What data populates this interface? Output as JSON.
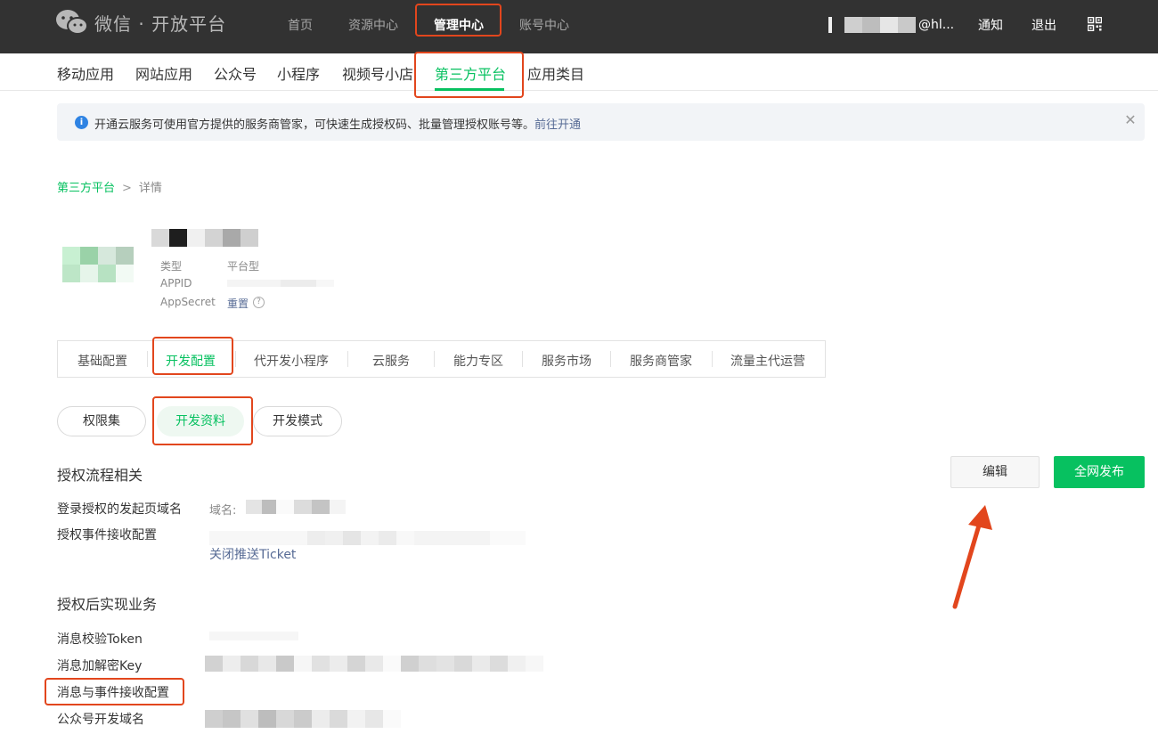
{
  "header": {
    "brand": "微信 · 开放平台",
    "nav": [
      "首页",
      "资源中心",
      "管理中心",
      "账号中心"
    ],
    "active_nav": "管理中心",
    "email_visible": "@hl...",
    "notify": "通知",
    "logout": "退出"
  },
  "subnav": {
    "items": [
      "移动应用",
      "网站应用",
      "公众号",
      "小程序",
      "视频号小店",
      "第三方平台",
      "应用类目"
    ],
    "active": "第三方平台"
  },
  "notice": {
    "text": "开通云服务可使用官方提供的服务商管家，可快速生成授权码、批量管理授权账号等。",
    "link": "前往开通"
  },
  "breadcrumb": {
    "parent": "第三方平台",
    "separator": ">",
    "current": "详情"
  },
  "app": {
    "type_label": "类型",
    "type_value": "平台型",
    "appid_label": "APPID",
    "appsecret_label": "AppSecret",
    "reset_link": "重置"
  },
  "tabs": {
    "items": [
      "基础配置",
      "开发配置",
      "代开发小程序",
      "云服务",
      "能力专区",
      "服务市场",
      "服务商管家",
      "流量主代运营"
    ],
    "active": "开发配置"
  },
  "pills": {
    "items": [
      "权限集",
      "开发资料",
      "开发模式"
    ],
    "active": "开发资料"
  },
  "section1": {
    "title": "授权流程相关",
    "rows": [
      {
        "label": "登录授权的发起页域名",
        "value": "域名:"
      },
      {
        "label": "授权事件接收配置",
        "value": ""
      }
    ],
    "close_ticket_link": "关闭推送Ticket"
  },
  "section2": {
    "title": "授权后实现业务",
    "rows": [
      {
        "label": "消息校验Token"
      },
      {
        "label": "消息加解密Key"
      },
      {
        "label": "消息与事件接收配置"
      },
      {
        "label": "公众号开发域名"
      }
    ]
  },
  "actions": {
    "edit": "编辑",
    "publish": "全网发布"
  },
  "colors": {
    "accent": "#07c160",
    "link": "#576b95",
    "annotation": "#e2461d",
    "topbar": "#323232"
  }
}
